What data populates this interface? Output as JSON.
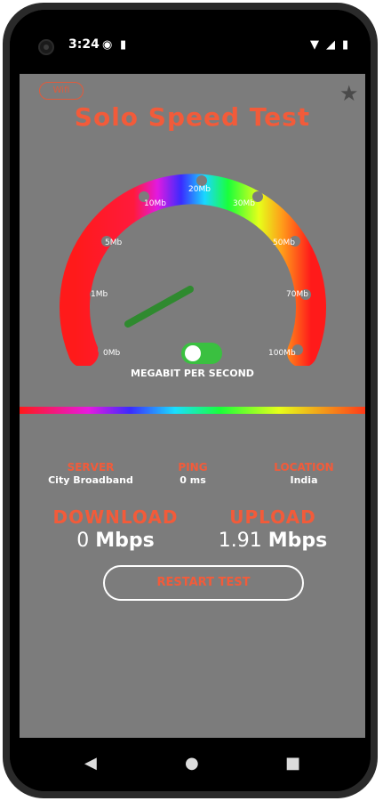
{
  "status_bar": {
    "time": "3:24"
  },
  "app": {
    "wifi_chip": "Wifi",
    "title": "Solo Speed Test",
    "star_icon": "star-icon"
  },
  "gauge": {
    "tick_labels": [
      "0Mb",
      "1Mb",
      "5Mb",
      "10Mb",
      "20Mb",
      "30Mb",
      "50Mb",
      "70Mb",
      "100Mb"
    ],
    "unit_label": "MEGABIT PER SECOND",
    "toggle_on": true
  },
  "info": {
    "server_label": "SERVER",
    "server_value": "City Broadband",
    "ping_label": "PING",
    "ping_value": "0 ms",
    "location_label": "LOCATION",
    "location_value": "India"
  },
  "results": {
    "download_label": "DOWNLOAD",
    "download_number": "0",
    "download_unit": "Mbps",
    "upload_label": "UPLOAD",
    "upload_number": "1.91",
    "upload_unit": "Mbps"
  },
  "restart_button": "RESTART TEST",
  "colors": {
    "accent": "#f25b3a",
    "screen_bg": "#7c7c7c",
    "toggle": "#3ac040"
  }
}
